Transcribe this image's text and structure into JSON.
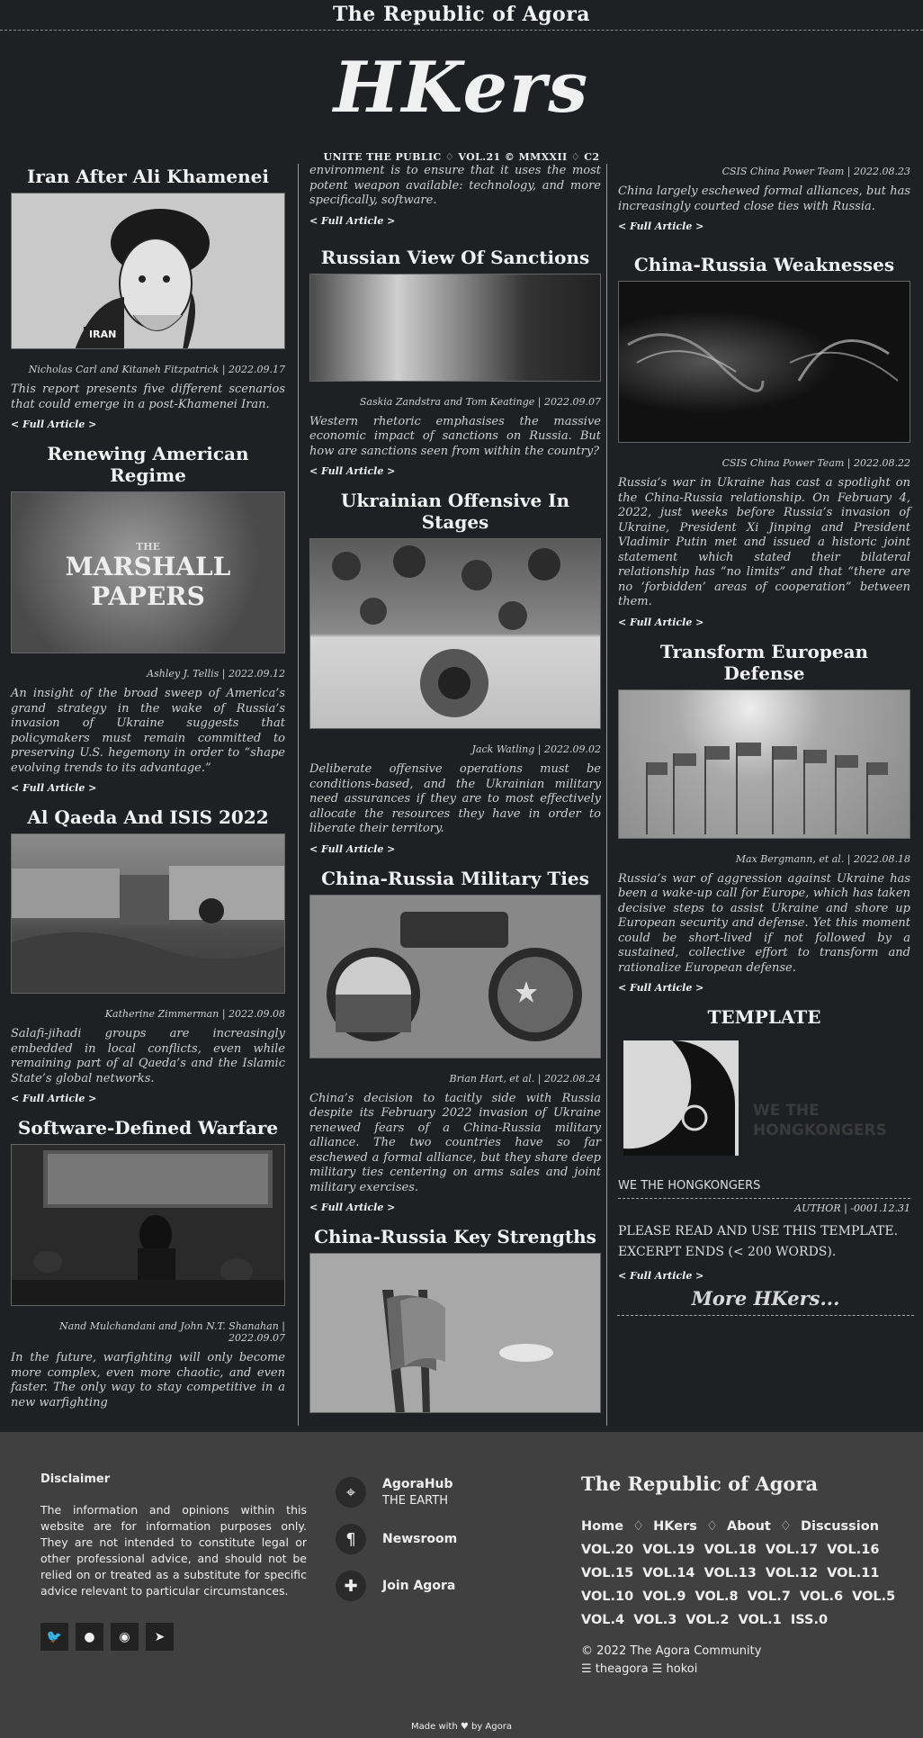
{
  "header": {
    "brand": "The Republic of Agora",
    "logo": "HKers",
    "tagline": "UNITE THE PUBLIC ♢ VOL.21 © MMXXII ♢ C2"
  },
  "read_more": "< Full Article >",
  "col1": [
    {
      "title": "Iran After Ali Khamenei",
      "author": "Nicholas Carl and Kitaneh Fitzpatrick | 2022.09.17",
      "excerpt": "This report presents five different scenarios that could emerge in a post-Khamenei Iran.",
      "img_label": "IRAN"
    },
    {
      "title": "Renewing American Regime",
      "author": "Ashley J. Tellis | 2022.09.12",
      "excerpt": "An insight of the broad sweep of America’s grand strategy in the wake of Russia’s invasion of Ukraine suggests that policymakers must remain committed to preserving U.S. hegemony in order to “shape evolving trends to its advantage.”",
      "img_label": "MARSHALL PAPERS",
      "img_label_small": "THE"
    },
    {
      "title": "Al Qaeda And ISIS 2022",
      "author": "Katherine Zimmerman | 2022.09.08",
      "excerpt": "Salafi-jihadi groups are increasingly embedded in local conflicts, even while remaining part of al Qaeda’s and the Islamic State’s global networks."
    },
    {
      "title": "Software-Defined Warfare",
      "author": "Nand Mulchandani and John N.T. Shanahan | 2022.09.07",
      "excerpt": "In the future, warfighting will only become more complex, even more chaotic, and even faster. The only way to stay competitive in a new warfighting"
    }
  ],
  "col2_fragment": "environment is to ensure that it uses the most potent weapon available: technology, and more specifically, software.",
  "col2": [
    {
      "title": "Russian View Of Sanctions",
      "author": "Saskia Zandstra and Tom Keatinge | 2022.09.07",
      "excerpt": "Western rhetoric emphasises the massive economic impact of sanctions on Russia. But how are sanctions seen from within the country?"
    },
    {
      "title": "Ukrainian Offensive In Stages",
      "author": "Jack Watling | 2022.09.02",
      "excerpt": "Deliberate offensive operations must be conditions-based, and the Ukrainian military need assurances if they are to most effectively allocate the resources they have in order to liberate their territory."
    },
    {
      "title": "China-Russia Military Ties",
      "author": "Brian Hart, et al. | 2022.08.24",
      "excerpt": "China’s decision to tacitly side with Russia despite its February 2022 invasion of Ukraine renewed fears of a China-Russia military alliance. The two countries have so far eschewed a formal alliance, but they share deep military ties centering on arms sales and joint military exercises."
    },
    {
      "title": "China-Russia Key Strengths"
    }
  ],
  "col3_fragment": {
    "author": "CSIS China Power Team | 2022.08.23",
    "excerpt": "China largely eschewed formal alliances, but has increasingly courted close ties with Russia."
  },
  "col3": [
    {
      "title": "China-Russia Weaknesses",
      "author": "CSIS China Power Team | 2022.08.22",
      "excerpt": "Russia’s war in Ukraine has cast a spotlight on the China-Russia relationship. On February 4, 2022, just weeks before Russia’s invasion of Ukraine, President Xi Jinping and President Vladimir Putin met and issued a historic joint statement which stated their bilateral relationship has “no limits” and that “there are no ‘forbidden’ areas of cooperation” between them."
    },
    {
      "title": "Transform European Defense",
      "author": "Max Bergmann, et al. | 2022.08.18",
      "excerpt": "Russia’s war of aggression against Ukraine has been a wake-up call for Europe, which has taken decisive steps to assist Ukraine and shore up European security and defense. Yet this moment could be short-lived if not followed by a sustained, collective effort to transform and rationalize European defense."
    }
  ],
  "template": {
    "title": "TEMPLATE",
    "img_line1": "WE THE",
    "img_line2": "HONGKONGERS",
    "name": "WE THE HONGKONGERS",
    "author": "AUTHOR | -0001.12.31",
    "line1": "PLEASE READ AND USE THIS TEMPLATE.",
    "line2": "EXCERPT ENDS (< 200 WORDS)."
  },
  "more_hkers": "More HKers...",
  "footer": {
    "disclaimer_title": "Disclaimer",
    "disclaimer": "The information and opinions within this website are for information purposes only. They are not intended to constitute legal or other professional advice, and should not be relied on or treated as a substitute for specific advice relevant to particular circumstances.",
    "contacts": [
      {
        "title": "AgoraHub",
        "sub": "THE EARTH"
      },
      {
        "title": "Newsroom"
      },
      {
        "title": "Join Agora"
      }
    ],
    "brand": "The Republic of Agora",
    "nav": [
      "Home",
      "♢",
      "HKers",
      "♢",
      "About",
      "♢",
      "Discussion"
    ],
    "vols_line1": [
      "VOL.20",
      "VOL.19",
      "VOL.18",
      "VOL.17",
      "VOL.16"
    ],
    "vols_line2": [
      "VOL.15",
      "VOL.14",
      "VOL.13",
      "VOL.12",
      "VOL.11"
    ],
    "vols_line3": [
      "VOL.10",
      "VOL.9",
      "VOL.8",
      "VOL.7",
      "VOL.6",
      "VOL.5"
    ],
    "vols_line4": [
      "VOL.4",
      "VOL.3",
      "VOL.2",
      "VOL.1",
      "ISS.0"
    ],
    "copyright": "© 2022 The Agora Community",
    "handles": "☰ theagora ☰ hokoi",
    "made_with": "Made with ♥ by Agora"
  },
  "icons": {
    "twitter": "twitter-icon",
    "github": "github-icon",
    "reddit": "reddit-icon",
    "telegram": "telegram-icon",
    "pin": "map-pin-icon",
    "paragraph": "paragraph-icon",
    "puzzle": "puzzle-icon"
  }
}
